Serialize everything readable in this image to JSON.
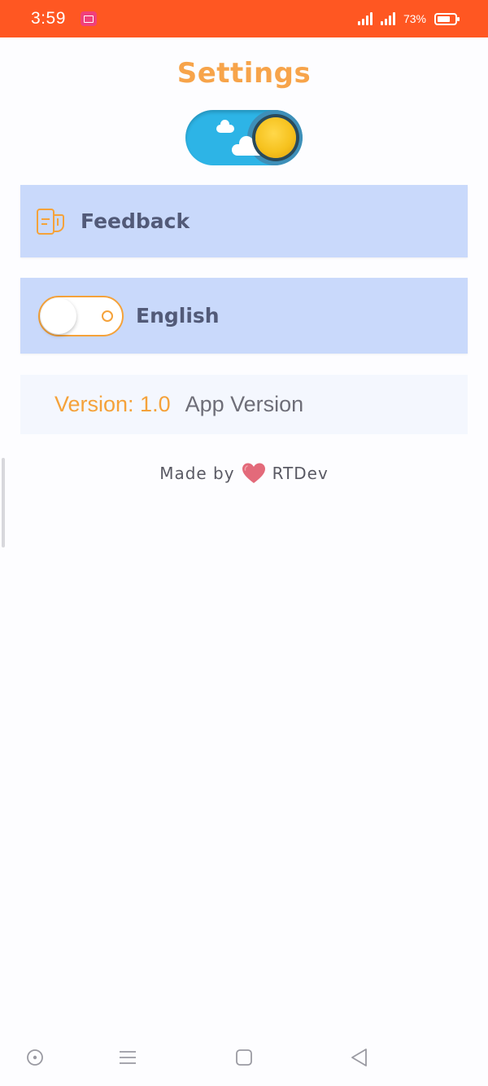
{
  "status_bar": {
    "time": "3:59",
    "battery_percent": "73%",
    "battery_level": 0.73,
    "background": "#ff5722"
  },
  "header": {
    "title": "Settings"
  },
  "theme_toggle": {
    "mode": "light",
    "icon": "sun-icon"
  },
  "feedback": {
    "label": "Feedback",
    "icon": "feedback-icon"
  },
  "language": {
    "label": "English",
    "toggle_on": false
  },
  "version": {
    "value": "Version: 1.0",
    "label": "App Version"
  },
  "footer": {
    "made_by": "Made by",
    "author": "RTDev",
    "icon": "heart-icon"
  },
  "nav_bar": {
    "buttons": [
      "assistant-icon",
      "menu-icon",
      "home-icon",
      "back-icon"
    ]
  },
  "colors": {
    "accent": "#f5a23a",
    "card": "#c9d9fb",
    "card_text": "#525a78"
  }
}
